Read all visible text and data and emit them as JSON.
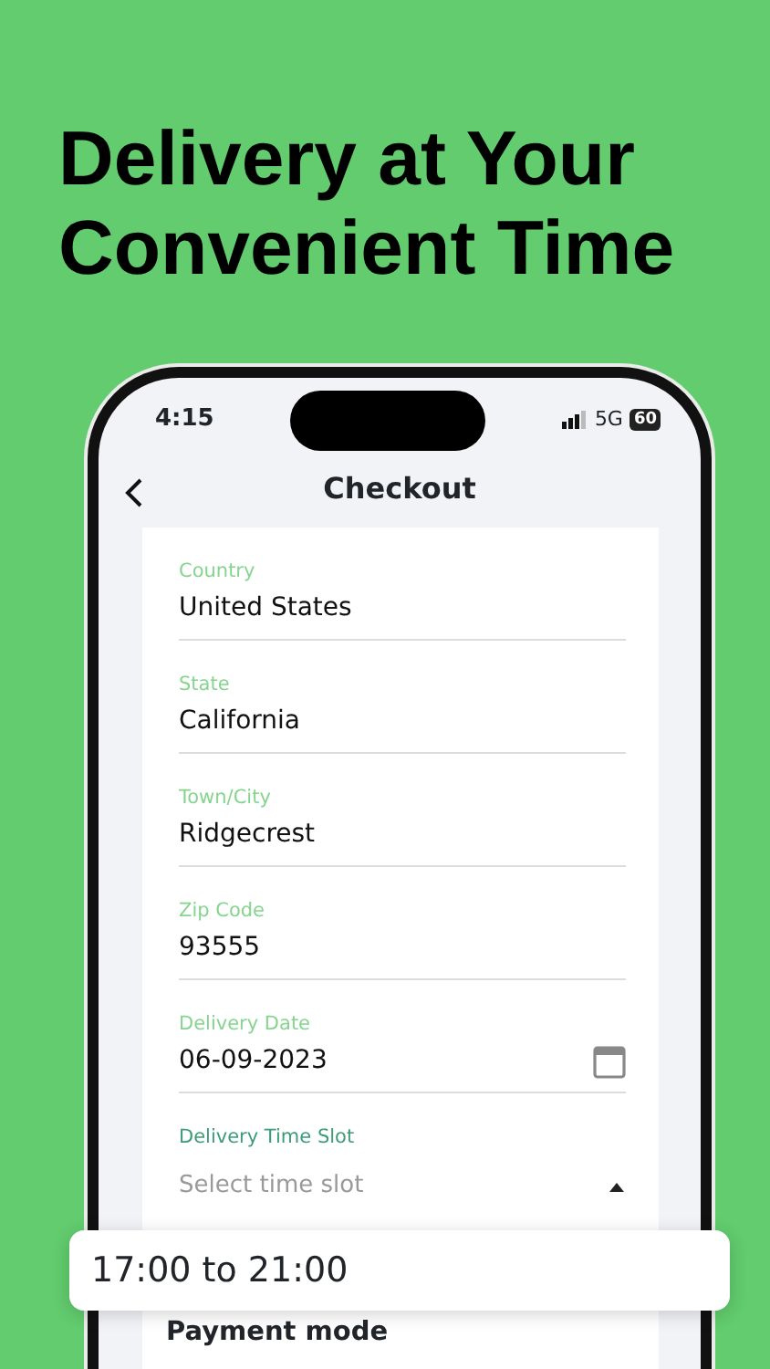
{
  "headline": [
    "Delivery at Your",
    "Convenient Time"
  ],
  "status_bar": {
    "time": "4:15",
    "network": "5G",
    "battery": "60"
  },
  "header": {
    "title": "Checkout"
  },
  "fields": [
    {
      "kind": "text",
      "label": "Country",
      "value": "United States"
    },
    {
      "kind": "text",
      "label": "State",
      "value": "California"
    },
    {
      "kind": "text",
      "label": "Town/City",
      "value": "Ridgecrest"
    },
    {
      "kind": "text",
      "label": "Zip Code",
      "value": "93555"
    },
    {
      "kind": "date",
      "label": "Delivery Date",
      "value": "06-09-2023"
    },
    {
      "kind": "select",
      "label": "Delivery Time Slot",
      "placeholder": "Select time slot",
      "expanded": true
    }
  ],
  "dropdown_option": "17:00 to 21:00",
  "section_title": "Payment mode"
}
